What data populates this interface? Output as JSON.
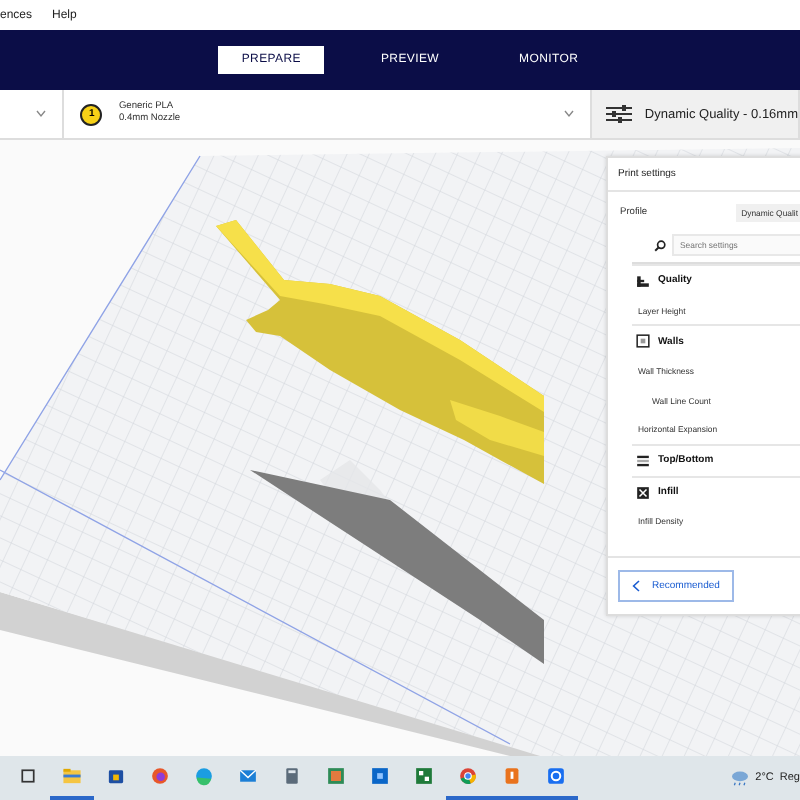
{
  "menu": [
    "ences",
    "Help"
  ],
  "tabs": [
    {
      "label": "PREPARE",
      "selected": true
    },
    {
      "label": "PREVIEW",
      "selected": false
    },
    {
      "label": "MONITOR",
      "selected": false
    }
  ],
  "toolbar": {
    "extruder_number": "1",
    "material": "Generic PLA",
    "nozzle": "0.4mm Nozzle",
    "quality": "Dynamic Quality - 0.16mm"
  },
  "print_settings": {
    "title": "Print settings",
    "profile_label": "Profile",
    "profile_value": "Dynamic Qualit",
    "search": {
      "placeholder": "Search settings"
    },
    "items": [
      {
        "kind": "category",
        "label": "Quality"
      },
      {
        "kind": "setting",
        "label": "Layer Height"
      },
      {
        "kind": "category",
        "label": "Walls"
      },
      {
        "kind": "setting",
        "label": "Wall Thickness",
        "children": [
          {
            "kind": "setting",
            "label": "Wall Line Count"
          }
        ]
      },
      {
        "kind": "setting",
        "label": "Horizontal Expansion"
      },
      {
        "kind": "category",
        "label": "Top/Bottom"
      },
      {
        "kind": "category",
        "label": "Infill"
      },
      {
        "kind": "setting",
        "label": "Infill Density"
      }
    ],
    "button": "Recommended"
  },
  "taskbar": {
    "apps": [
      {
        "kind": "taskview",
        "active": false
      },
      {
        "kind": "folder",
        "active": true
      },
      {
        "kind": "store",
        "active": false
      },
      {
        "kind": "firefox",
        "active": false
      },
      {
        "kind": "edge",
        "active": false
      },
      {
        "kind": "mail",
        "active": false
      },
      {
        "kind": "calculator",
        "active": false
      },
      {
        "kind": "photos",
        "active": false
      },
      {
        "kind": "blue-app",
        "active": false
      },
      {
        "kind": "green-app",
        "active": false
      },
      {
        "kind": "chrome",
        "active": true
      },
      {
        "kind": "orange-app",
        "active": true
      },
      {
        "kind": "cura",
        "active": true
      }
    ],
    "temperature": "2°C",
    "weather": "Reg"
  }
}
